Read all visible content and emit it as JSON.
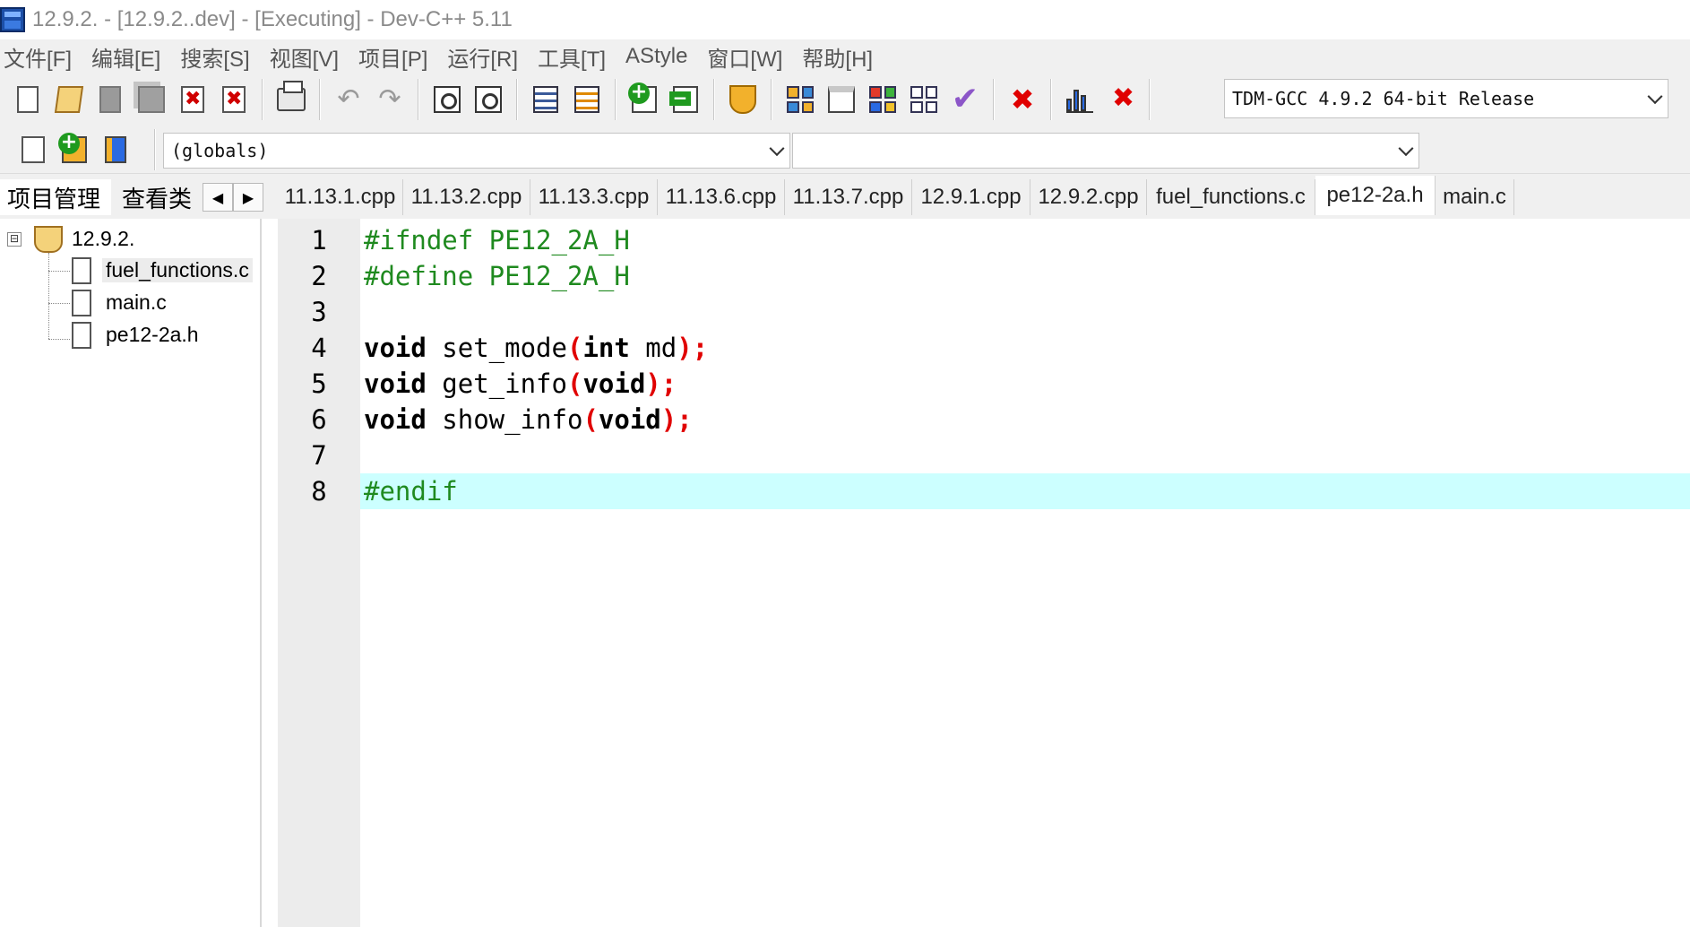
{
  "window": {
    "title": "12.9.2. - [12.9.2..dev] - [Executing] - Dev-C++ 5.11"
  },
  "menu": [
    "文件[F]",
    "编辑[E]",
    "搜索[S]",
    "视图[V]",
    "项目[P]",
    "运行[R]",
    "工具[T]",
    "AStyle",
    "窗口[W]",
    "帮助[H]"
  ],
  "toolbar": {
    "compiler_select": "TDM-GCC 4.9.2 64-bit Release",
    "scope_select": "(globals)",
    "member_select": ""
  },
  "left_tabs": {
    "project": "项目管理",
    "classes": "查看类",
    "scroll_left": "◀",
    "scroll_right": "▶"
  },
  "file_tabs": [
    {
      "label": "11.13.1.cpp"
    },
    {
      "label": "11.13.2.cpp"
    },
    {
      "label": "11.13.3.cpp"
    },
    {
      "label": "11.13.6.cpp"
    },
    {
      "label": "11.13.7.cpp"
    },
    {
      "label": "12.9.1.cpp"
    },
    {
      "label": "12.9.2.cpp"
    },
    {
      "label": "fuel_functions.c"
    },
    {
      "label": "pe12-2a.h"
    },
    {
      "label": "main.c"
    }
  ],
  "active_tab": "pe12-2a.h",
  "tree": {
    "toggle": "⊟",
    "project": "12.9.2.",
    "files": [
      "fuel_functions.c",
      "main.c",
      "pe12-2a.h"
    ]
  },
  "editor": {
    "current_line": 8,
    "lines": [
      {
        "n": "1",
        "tokens": [
          {
            "t": "#ifndef PE12_2A_H",
            "k": "pre"
          }
        ]
      },
      {
        "n": "2",
        "tokens": [
          {
            "t": "#define PE12_2A_H",
            "k": "pre"
          }
        ]
      },
      {
        "n": "3",
        "tokens": []
      },
      {
        "n": "4",
        "tokens": [
          {
            "t": "void",
            "k": "kw"
          },
          {
            "t": " set_mode",
            "k": "id"
          },
          {
            "t": "(",
            "k": "sym"
          },
          {
            "t": "int",
            "k": "kw"
          },
          {
            "t": " md",
            "k": "id"
          },
          {
            "t": ");",
            "k": "sym"
          }
        ]
      },
      {
        "n": "5",
        "tokens": [
          {
            "t": "void",
            "k": "kw"
          },
          {
            "t": " get_info",
            "k": "id"
          },
          {
            "t": "(",
            "k": "sym"
          },
          {
            "t": "void",
            "k": "kw"
          },
          {
            "t": ");",
            "k": "sym"
          }
        ]
      },
      {
        "n": "6",
        "tokens": [
          {
            "t": "void",
            "k": "kw"
          },
          {
            "t": " show_info",
            "k": "id"
          },
          {
            "t": "(",
            "k": "sym"
          },
          {
            "t": "void",
            "k": "kw"
          },
          {
            "t": ");",
            "k": "sym"
          }
        ]
      },
      {
        "n": "7",
        "tokens": []
      },
      {
        "n": "8",
        "tokens": [
          {
            "t": "#endif",
            "k": "pre"
          }
        ]
      }
    ]
  },
  "colors": {
    "preprocessor": "#1f8a1f",
    "symbol": "#e00000",
    "current_line_bg": "#ccffff",
    "gutter_bg": "#ececec"
  }
}
